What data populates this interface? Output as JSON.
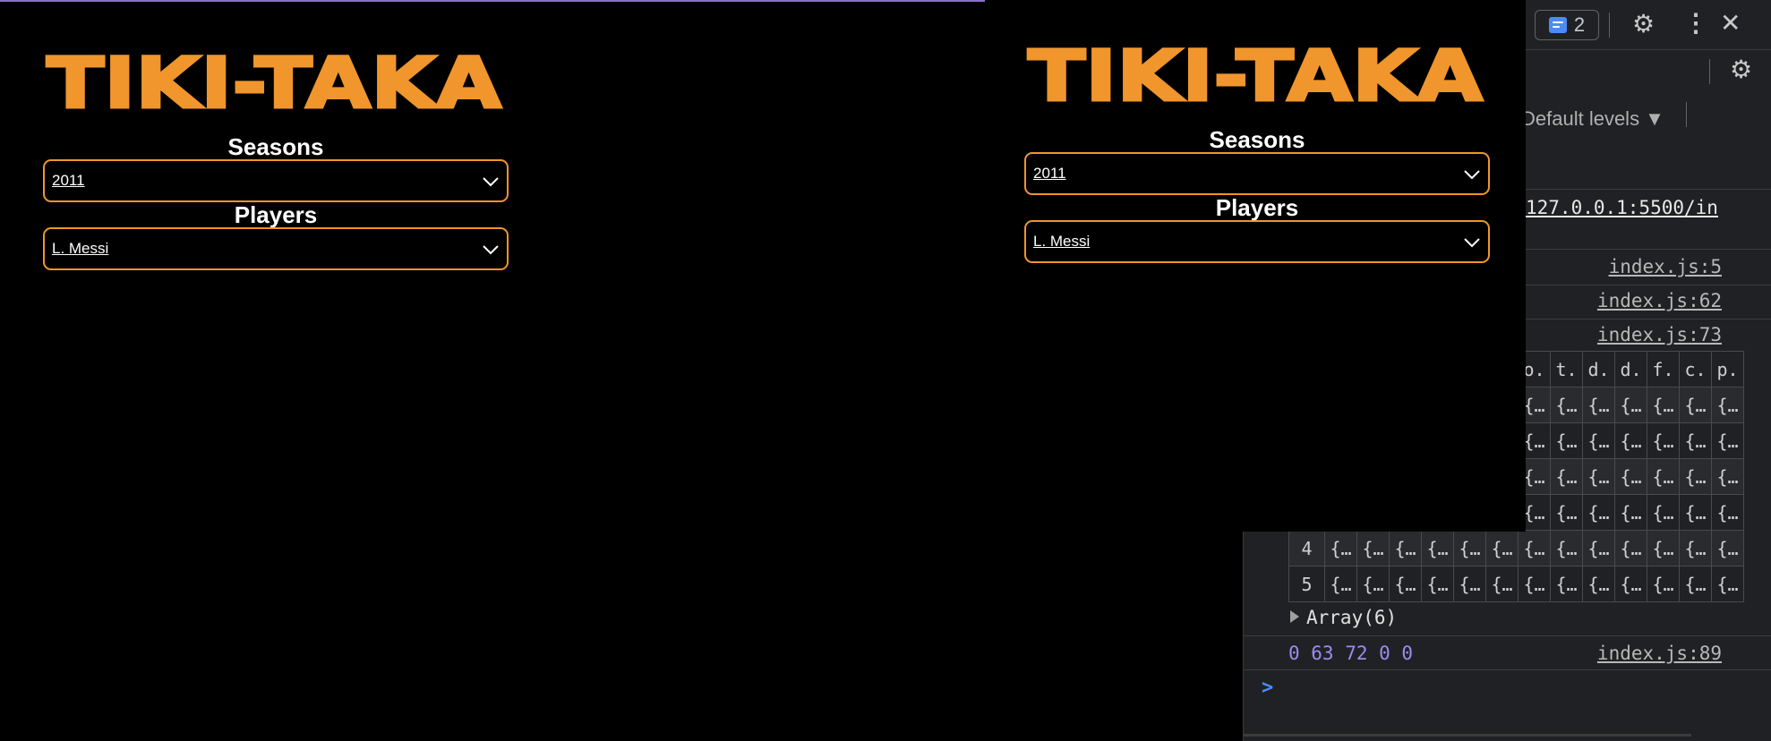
{
  "app": {
    "logo_text": "TIKI-TAKA",
    "seasons_label": "Seasons",
    "season_value": "2011",
    "players_label": "Players",
    "player_value": "L. Messi"
  },
  "devtools": {
    "message_count": "2",
    "levels_label": "Default levels ▼",
    "url": "127.0.0.1:5500/in",
    "source_links": [
      "index.js:5",
      "index.js:62",
      "index.js:73"
    ],
    "table_headers": [
      "o.",
      "t.",
      "d.",
      "d.",
      "f.",
      "c.",
      "p."
    ],
    "cell_value": "{…",
    "row_indices": [
      "4",
      "5"
    ],
    "array_label": "Array(6)",
    "numbers_output": "0 63 72 0 0",
    "numbers_source": "index.js:89",
    "prompt": ">"
  },
  "colors": {
    "accent_orange": "#f0962c",
    "background": "#000000",
    "devtools_bg": "#202124",
    "log_number_color": "#9a8cf2"
  }
}
